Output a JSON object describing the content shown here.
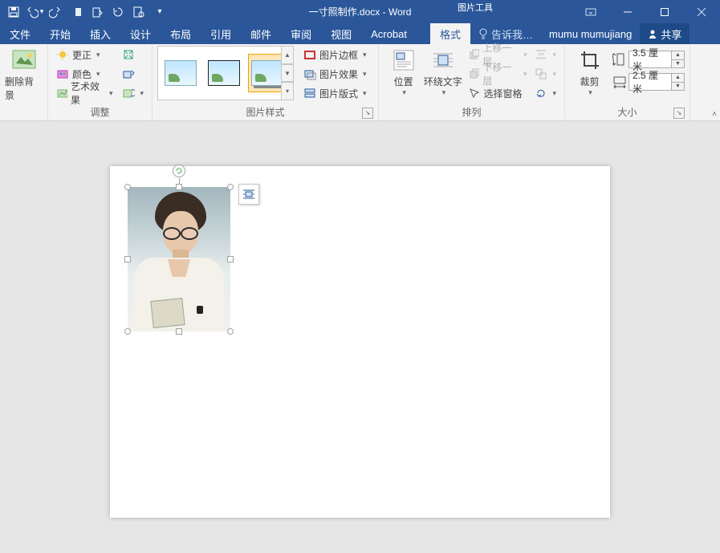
{
  "title": {
    "doc": "一寸照制作.docx",
    "app": "Word",
    "context_group": "图片工具"
  },
  "window": {
    "user": "mumu mumujiang",
    "share": "共享",
    "tell_me": "告诉我…"
  },
  "tabs": {
    "file": "文件",
    "home": "开始",
    "insert": "插入",
    "design": "设计",
    "layout": "布局",
    "references": "引用",
    "mailings": "邮件",
    "review": "审阅",
    "view": "视图",
    "acrobat": "Acrobat",
    "format": "格式"
  },
  "ribbon": {
    "bg_remove": "删除背景",
    "adjust": {
      "label": "调整",
      "corrections": "更正",
      "color": "颜色",
      "artistic": "艺术效果"
    },
    "styles": {
      "label": "图片样式",
      "border": "图片边框",
      "effects": "图片效果",
      "layout": "图片版式"
    },
    "arrange": {
      "label": "排列",
      "position": "位置",
      "wrap": "环绕文字",
      "forward": "上移一层",
      "backward": "下移一层",
      "selection": "选择窗格"
    },
    "size": {
      "label": "大小",
      "crop": "裁剪",
      "height": "3.5 厘米",
      "width": "2.5 厘米"
    }
  }
}
